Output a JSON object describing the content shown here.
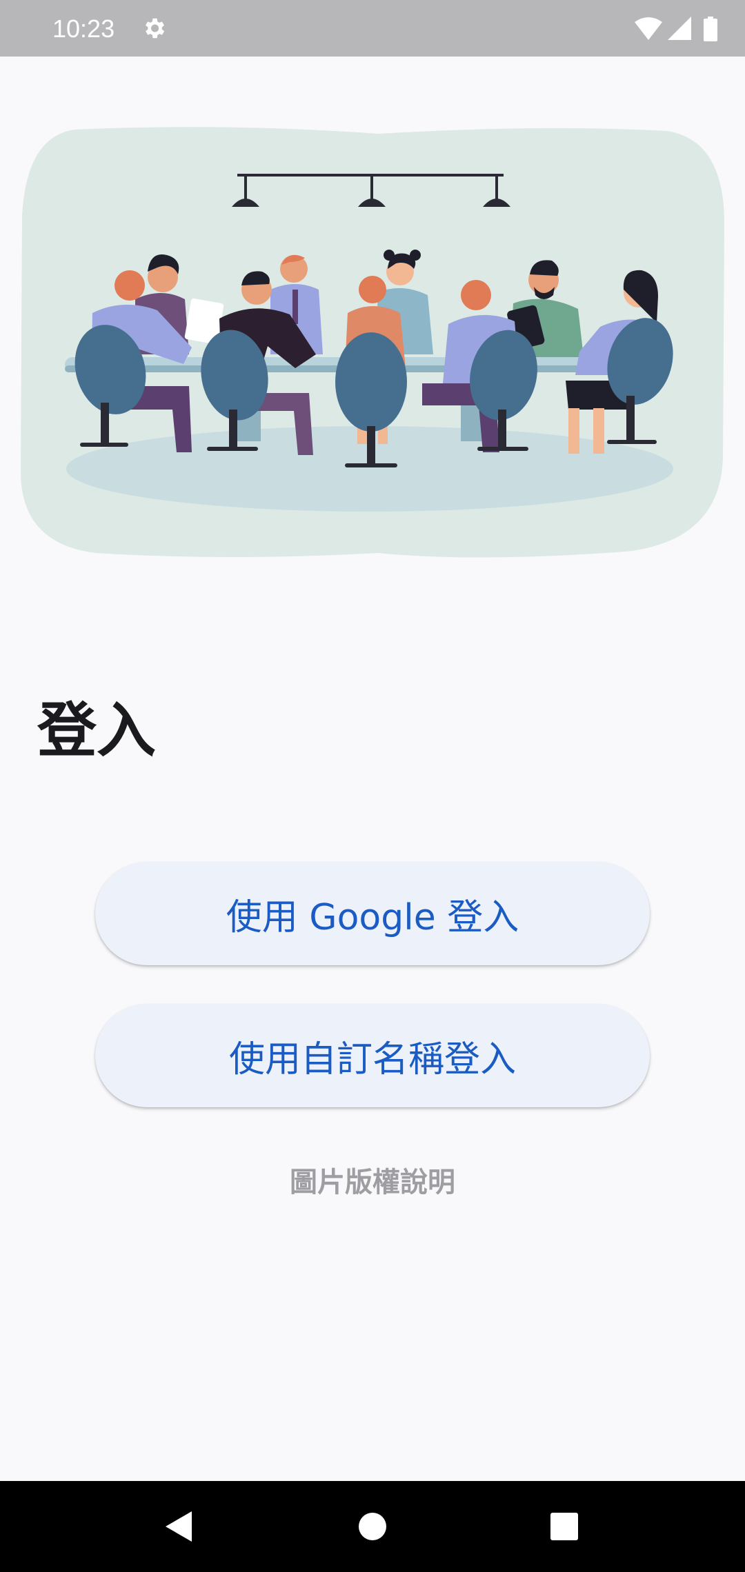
{
  "status_bar": {
    "time": "10:23",
    "icons": [
      "settings-gear-icon",
      "wifi-icon",
      "cell-signal-icon",
      "battery-icon"
    ]
  },
  "illustration": {
    "description_icon": "meeting-illustration"
  },
  "login": {
    "title": "登入",
    "google_button_label": "使用 Google 登入",
    "custom_name_button_label": "使用自訂名稱登入",
    "image_copyright_link": "圖片版權說明"
  },
  "nav_bar": {
    "icons": [
      "back-icon",
      "home-icon",
      "recents-icon"
    ]
  },
  "colors": {
    "background": "#f9f9fc",
    "status_bar": "#b7b7b9",
    "button_bg": "#edf2fa",
    "button_text": "#1a5bc4",
    "link_text": "#9d9da2",
    "illustration_bg": "#dce9e5",
    "chair": "#466f8f",
    "shirt_lavender": "#9aa4e0",
    "pants_purple": "#5b3f6e"
  }
}
